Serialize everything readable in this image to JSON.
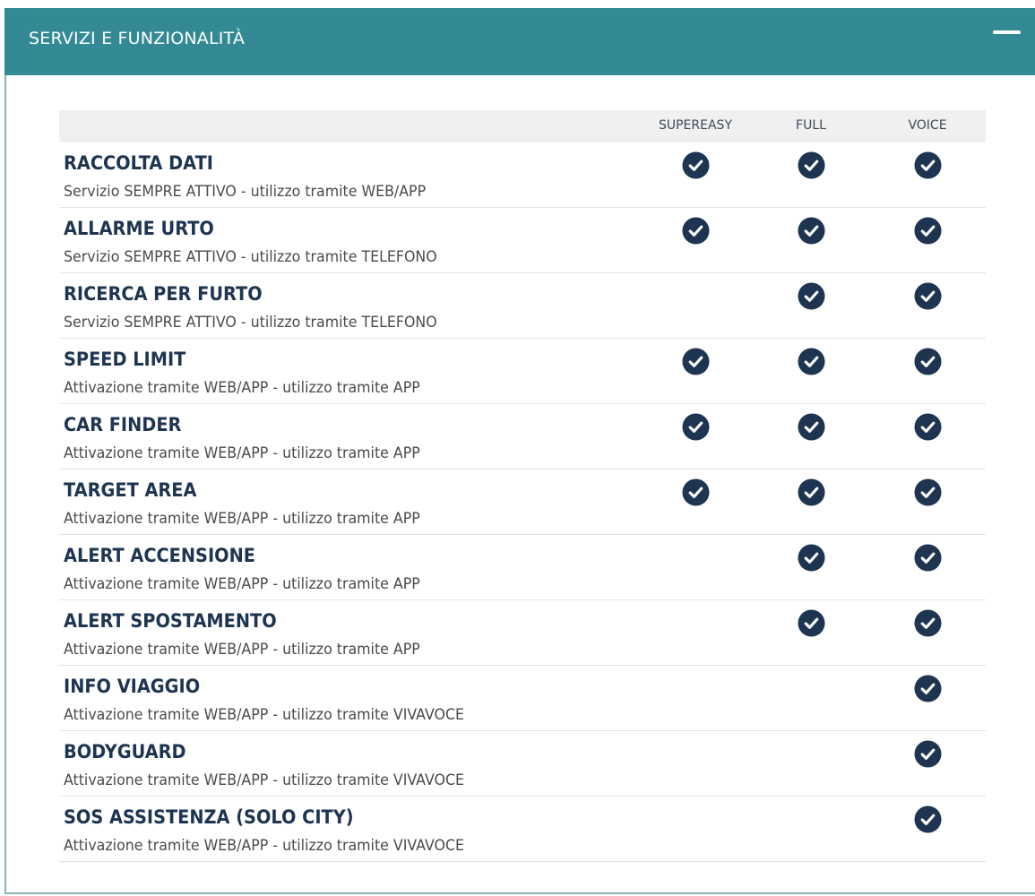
{
  "panel": {
    "title": "SERVIZI E FUNZIONALITÀ",
    "header_color": "#338a95",
    "collapse_icon": "minus-icon"
  },
  "table": {
    "columns": [
      "SUPEREASY",
      "FULL",
      "VOICE"
    ],
    "check_icon": "check-circle-icon",
    "check_color": "#1d3551",
    "rows": [
      {
        "title": "RACCOLTA DATI",
        "description": "Servizio SEMPRE ATTIVO - utilizzo tramite WEB/APP",
        "supereasy": true,
        "full": true,
        "voice": true
      },
      {
        "title": "ALLARME URTO",
        "description": "Servizio SEMPRE ATTIVO - utilizzo tramite TELEFONO",
        "supereasy": true,
        "full": true,
        "voice": true
      },
      {
        "title": "RICERCA PER FURTO",
        "description": "Servizio SEMPRE ATTIVO - utilizzo tramite TELEFONO",
        "supereasy": false,
        "full": true,
        "voice": true
      },
      {
        "title": "SPEED LIMIT",
        "description": "Attivazione tramite WEB/APP - utilizzo tramite APP",
        "supereasy": true,
        "full": true,
        "voice": true
      },
      {
        "title": "CAR FINDER",
        "description": "Attivazione tramite WEB/APP - utilizzo tramite APP",
        "supereasy": true,
        "full": true,
        "voice": true
      },
      {
        "title": "TARGET AREA",
        "description": "Attivazione tramite WEB/APP - utilizzo tramite APP",
        "supereasy": true,
        "full": true,
        "voice": true
      },
      {
        "title": "ALERT ACCENSIONE",
        "description": "Attivazione tramite WEB/APP - utilizzo tramite APP",
        "supereasy": false,
        "full": true,
        "voice": true
      },
      {
        "title": "ALERT SPOSTAMENTO",
        "description": "Attivazione tramite WEB/APP - utilizzo tramite APP",
        "supereasy": false,
        "full": true,
        "voice": true
      },
      {
        "title": "INFO VIAGGIO",
        "description": "Attivazione tramite WEB/APP - utilizzo tramite VIVAVOCE",
        "supereasy": false,
        "full": false,
        "voice": true
      },
      {
        "title": "BODYGUARD",
        "description": "Attivazione tramite WEB/APP - utilizzo tramite VIVAVOCE",
        "supereasy": false,
        "full": false,
        "voice": true
      },
      {
        "title": "SOS ASSISTENZA (SOLO CITY)",
        "description": "Attivazione tramite WEB/APP - utilizzo tramite VIVAVOCE",
        "supereasy": false,
        "full": false,
        "voice": true
      }
    ]
  }
}
